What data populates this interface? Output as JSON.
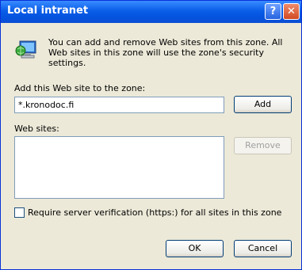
{
  "window": {
    "title": "Local intranet",
    "help_glyph": "?",
    "close_glyph": "✕"
  },
  "info": {
    "text": "You can add and remove Web sites from this zone. All Web sites in this zone will use the zone's security settings."
  },
  "add_site": {
    "label": "Add this Web site to the zone:",
    "value": "*.kronodoc.fi",
    "button": "Add"
  },
  "sites": {
    "label": "Web sites:",
    "remove_button": "Remove"
  },
  "verify": {
    "label": "Require server verification (https:) for all sites in this zone",
    "checked": false
  },
  "footer": {
    "ok": "OK",
    "cancel": "Cancel"
  },
  "colors": {
    "titlebar": "#0A5EE8",
    "dialog_bg": "#ECE9D8",
    "border": "#7F9DB9"
  },
  "icons": {
    "zone": "intranet-zone-icon"
  }
}
